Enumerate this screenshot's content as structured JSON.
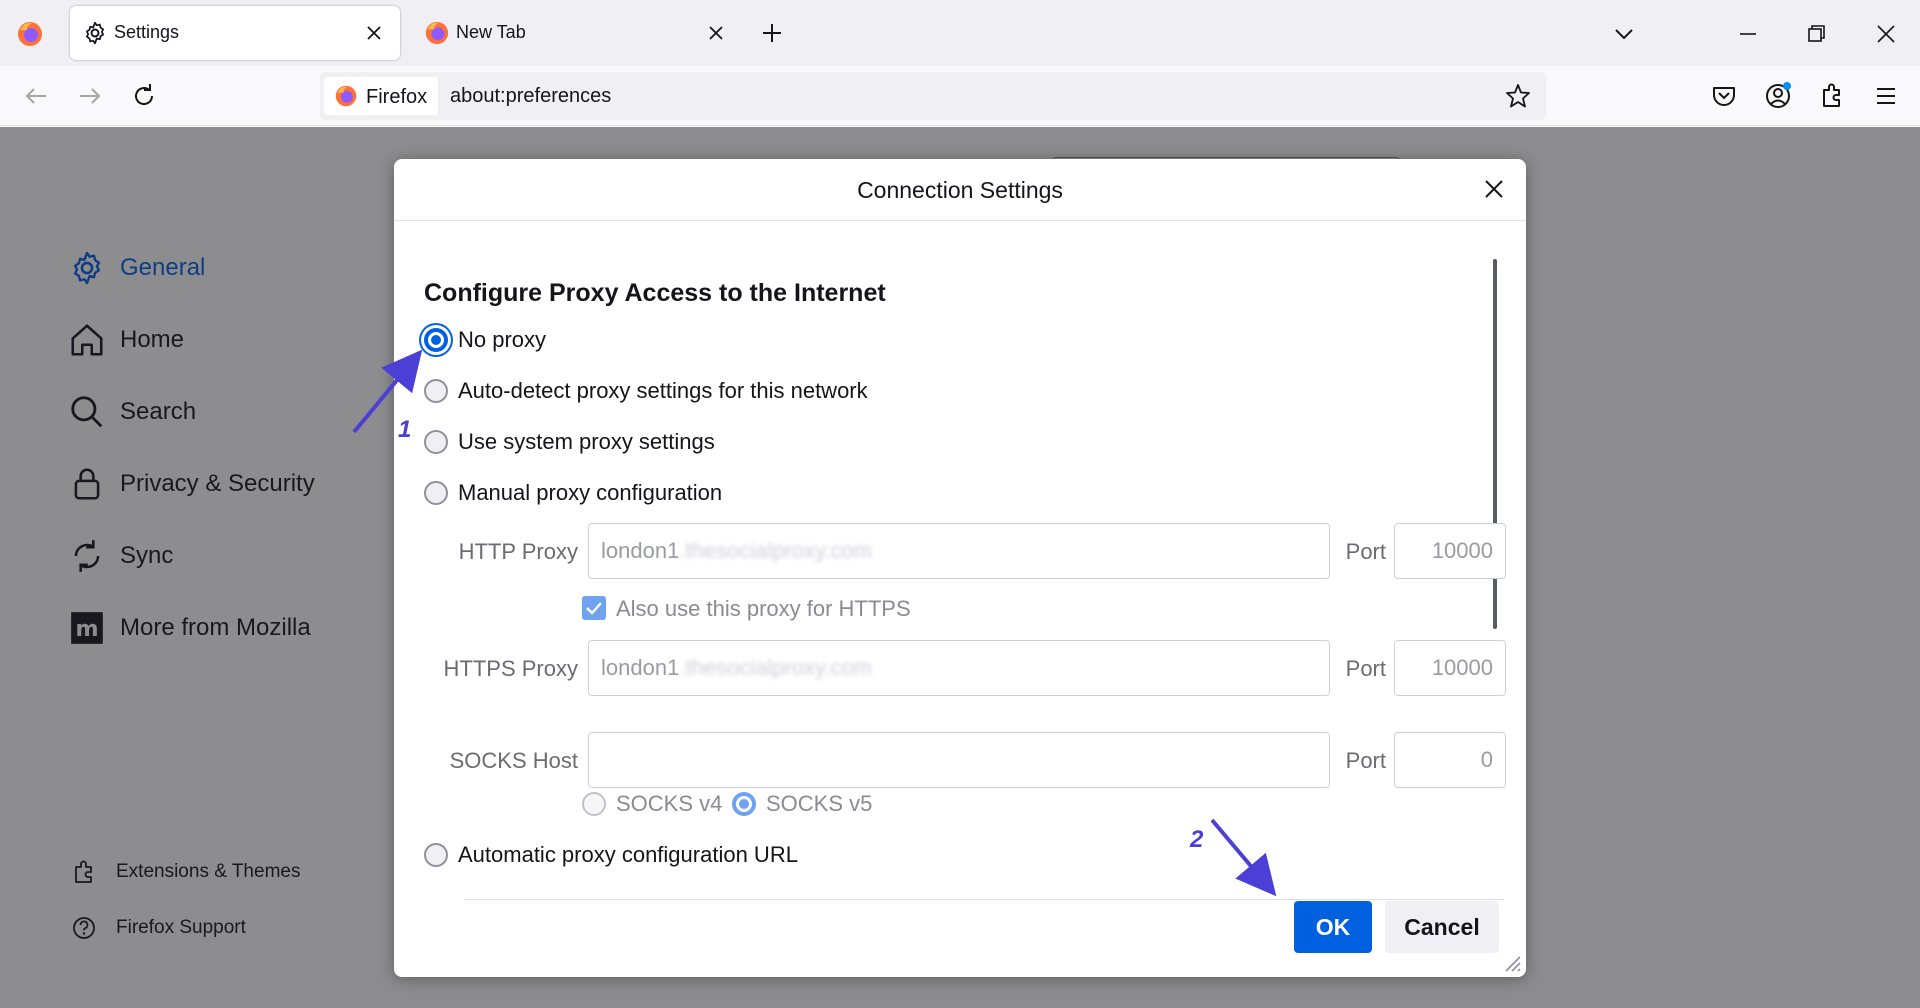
{
  "tabs": [
    {
      "title": "Settings",
      "icon": "gear-icon",
      "active": true
    },
    {
      "title": "New Tab",
      "icon": "firefox-logo-icon",
      "active": false
    }
  ],
  "navbar": {
    "identity_label": "Firefox",
    "url": "about:preferences"
  },
  "sidebar": {
    "items": [
      {
        "label": "General",
        "icon": "gear-icon",
        "selected": true
      },
      {
        "label": "Home",
        "icon": "home-icon"
      },
      {
        "label": "Search",
        "icon": "search-icon"
      },
      {
        "label": "Privacy & Security",
        "icon": "lock-icon"
      },
      {
        "label": "Sync",
        "icon": "sync-icon"
      },
      {
        "label": "More from Mozilla",
        "icon": "mozilla-icon"
      }
    ],
    "footer": [
      {
        "label": "Extensions & Themes",
        "icon": "puzzle-icon"
      },
      {
        "label": "Firefox Support",
        "icon": "help-icon"
      }
    ]
  },
  "dialog": {
    "title": "Connection Settings",
    "section_title": "Configure Proxy Access to the Internet",
    "options": {
      "no_proxy": "No proxy",
      "auto_detect": "Auto-detect proxy settings for this network",
      "system": "Use system proxy settings",
      "manual": "Manual proxy configuration",
      "auto_url": "Automatic proxy configuration URL"
    },
    "selected_option": "no_proxy",
    "http_proxy": {
      "label": "HTTP Proxy",
      "value": "london1",
      "value_blurred": ".thesocialproxy.com",
      "port_label": "Port",
      "port": "10000"
    },
    "also_https": {
      "label": "Also use this proxy for HTTPS",
      "checked": true
    },
    "https_proxy": {
      "label": "HTTPS Proxy",
      "value": "london1",
      "value_blurred": ".thesocialproxy.com",
      "port_label": "Port",
      "port": "10000"
    },
    "socks": {
      "label": "SOCKS Host",
      "value": "",
      "port_label": "Port",
      "port": "0",
      "v4": "SOCKS v4",
      "v5": "SOCKS v5",
      "selected": "v5"
    },
    "ok_label": "OK",
    "cancel_label": "Cancel"
  },
  "annotations": {
    "one": "1",
    "two": "2",
    "color": "#4b3fd6"
  },
  "colors": {
    "accent": "#0061e0",
    "chrome_bg": "#f0f0f4",
    "overlay": "#1c1b22"
  }
}
